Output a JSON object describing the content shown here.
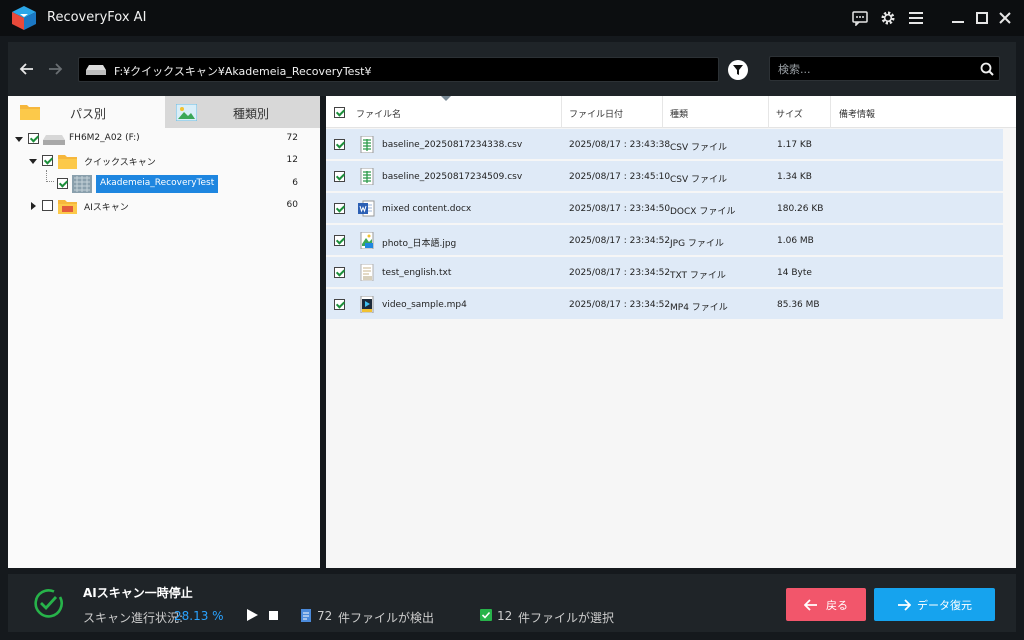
{
  "app": {
    "title": "RecoveryFox AI"
  },
  "nav": {
    "path": "F:¥クイックスキャン¥Akademeia_RecoveryTest¥",
    "search_placeholder": "検索..."
  },
  "left": {
    "tabs": [
      {
        "label": "パス別"
      },
      {
        "label": "種類別"
      }
    ],
    "tree": [
      {
        "label": "FH6M2_A02 (F:)",
        "count": "72"
      },
      {
        "label": "クイックスキャン",
        "count": "12"
      },
      {
        "label": "Akademeia_RecoveryTest",
        "count": "6"
      },
      {
        "label": "AIスキャン",
        "count": "60"
      }
    ]
  },
  "table": {
    "columns": [
      "ファイル名",
      "ファイル日付",
      "種類",
      "サイズ",
      "備考情報"
    ],
    "rows": [
      {
        "name": "baseline_20250817234338.csv",
        "date": "2025/08/17 : 23:43:38",
        "type": "CSV ファイル",
        "size": "1.17 KB",
        "note": "",
        "icon": "csv-file-icon"
      },
      {
        "name": "baseline_20250817234509.csv",
        "date": "2025/08/17 : 23:45:10",
        "type": "CSV ファイル",
        "size": "1.34 KB",
        "note": "",
        "icon": "csv-file-icon"
      },
      {
        "name": "mixed content.docx",
        "date": "2025/08/17 : 23:34:50",
        "type": "DOCX ファイル",
        "size": "180.26 KB",
        "note": "",
        "icon": "word-file-icon"
      },
      {
        "name": "photo_日本語.jpg",
        "date": "2025/08/17 : 23:34:52",
        "type": "JPG ファイル",
        "size": "1.06 MB",
        "note": "",
        "icon": "image-file-icon"
      },
      {
        "name": "test_english.txt",
        "date": "2025/08/17 : 23:34:52",
        "type": "TXT ファイル",
        "size": "14 Byte",
        "note": "",
        "icon": "text-file-icon"
      },
      {
        "name": "video_sample.mp4",
        "date": "2025/08/17 : 23:34:52",
        "type": "MP4 ファイル",
        "size": "85.36 MB",
        "note": "",
        "icon": "video-file-icon"
      }
    ]
  },
  "status": {
    "title": "AIスキャン一時停止",
    "progress_label": "スキャン進行状況:",
    "progress_value": "28.13 %",
    "found_count": "72",
    "found_label": "件ファイルが検出",
    "selected_count": "12",
    "selected_label": "件ファイルが選択"
  },
  "buttons": {
    "back": "戻る",
    "recover": "データ復元"
  },
  "colors": {
    "accent_blue": "#16a3ee",
    "back_red": "#f2566b",
    "row_selected": "#dfeaf7"
  }
}
